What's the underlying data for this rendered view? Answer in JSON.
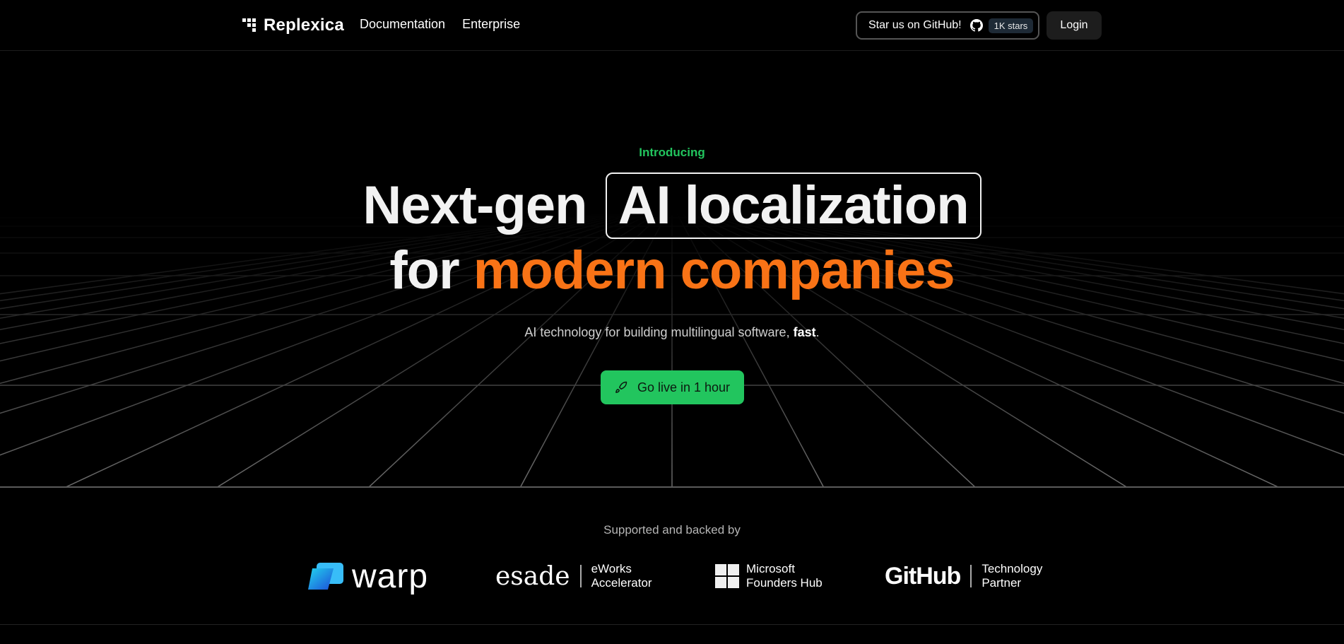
{
  "header": {
    "brand": "Replexica",
    "nav": [
      {
        "label": "Documentation"
      },
      {
        "label": "Enterprise"
      }
    ],
    "github_button": {
      "label": "Star us on GitHub!",
      "stars": "1K stars"
    },
    "login_label": "Login"
  },
  "hero": {
    "intro": "Introducing",
    "headline_line1_prefix": "Next-gen",
    "headline_line1_boxed": "AI localization",
    "headline_line2_prefix": "for",
    "headline_line2_highlight": "modern companies",
    "subtitle_text": "AI technology for building multilingual software,",
    "subtitle_bold": "fast",
    "subtitle_end": ".",
    "cta_label": "Go live in 1 hour"
  },
  "supporters": {
    "title": "Supported and backed by",
    "warp": "warp",
    "esade": {
      "name": "esade",
      "line1": "eWorks",
      "line2": "Accelerator"
    },
    "microsoft": {
      "line1": "Microsoft",
      "line2": "Founders Hub"
    },
    "github": {
      "name": "GitHub",
      "line1": "Technology",
      "line2": "Partner"
    }
  },
  "colors": {
    "accent_green": "#22c55e",
    "accent_orange": "#f97316",
    "background": "#000000"
  },
  "icons": [
    "logo-icon",
    "github-icon",
    "rocket-icon",
    "warp-logo-icon",
    "microsoft-logo-icon"
  ]
}
